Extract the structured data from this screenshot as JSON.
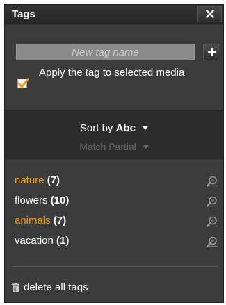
{
  "header": {
    "title": "Tags",
    "close_icon": "close-icon"
  },
  "new_tag": {
    "placeholder": "New tag name",
    "value": "",
    "add_icon": "plus-icon"
  },
  "apply": {
    "label": "Apply the tag to selected media",
    "checked": true
  },
  "sort": {
    "label": "Sort by",
    "value": "Abc"
  },
  "match": {
    "label": "Match",
    "value": "Partial",
    "disabled": true
  },
  "tags": [
    {
      "name": "nature",
      "count": "(7)",
      "highlighted": true
    },
    {
      "name": "flowers",
      "count": "(10)",
      "highlighted": false
    },
    {
      "name": "animals",
      "count": "(7)",
      "highlighted": true
    },
    {
      "name": "vacation",
      "count": "(1)",
      "highlighted": false
    }
  ],
  "footer": {
    "delete_label": "delete all tags",
    "icon": "trash-icon"
  },
  "colors": {
    "panel_bg": "#3b3b3b",
    "sort_bg": "#2c2c2c",
    "highlight": "#f0a020",
    "check": "#f0a020"
  }
}
